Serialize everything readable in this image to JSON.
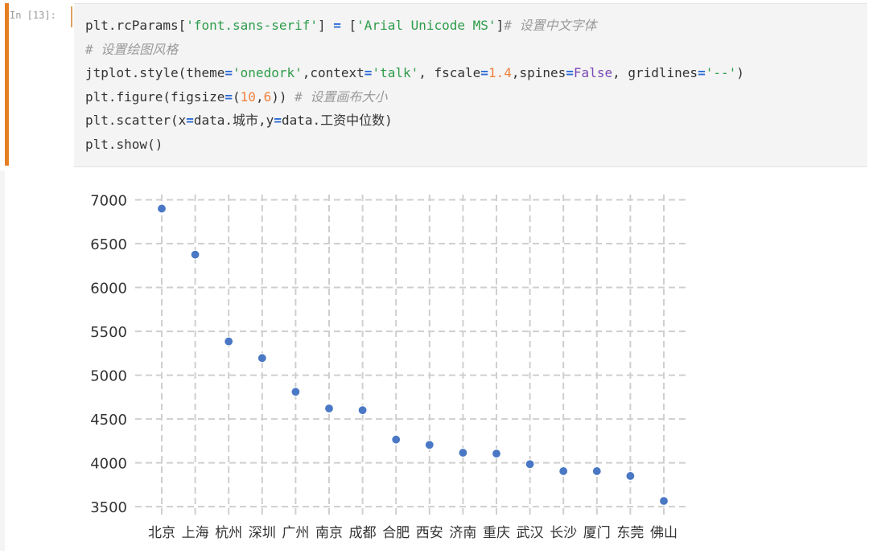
{
  "cell": {
    "prompt": "In [13]:",
    "code_lines": [
      [
        {
          "t": "plt.rcParams[",
          "c": ""
        },
        {
          "t": "'font.sans-serif'",
          "c": "str"
        },
        {
          "t": "] ",
          "c": ""
        },
        {
          "t": "=",
          "c": "op"
        },
        {
          "t": " [",
          "c": ""
        },
        {
          "t": "'Arial Unicode MS'",
          "c": "str"
        },
        {
          "t": "]",
          "c": ""
        },
        {
          "t": "# 设置中文字体",
          "c": "cm"
        }
      ],
      [
        {
          "t": "# 设置绘图风格",
          "c": "cm"
        }
      ],
      [
        {
          "t": "jtplot.style(theme",
          "c": ""
        },
        {
          "t": "=",
          "c": "op"
        },
        {
          "t": "'onedork'",
          "c": "str"
        },
        {
          "t": ",context",
          "c": ""
        },
        {
          "t": "=",
          "c": "op"
        },
        {
          "t": "'talk'",
          "c": "str"
        },
        {
          "t": ", fscale",
          "c": ""
        },
        {
          "t": "=",
          "c": "op"
        },
        {
          "t": "1.4",
          "c": "num"
        },
        {
          "t": ",spines",
          "c": ""
        },
        {
          "t": "=",
          "c": "op"
        },
        {
          "t": "False",
          "c": "kw"
        },
        {
          "t": ", gridlines",
          "c": ""
        },
        {
          "t": "=",
          "c": "op"
        },
        {
          "t": "'--'",
          "c": "str"
        },
        {
          "t": ")",
          "c": ""
        }
      ],
      [
        {
          "t": "plt.figure(figsize",
          "c": ""
        },
        {
          "t": "=",
          "c": "op"
        },
        {
          "t": "(",
          "c": ""
        },
        {
          "t": "10",
          "c": "num"
        },
        {
          "t": ",",
          "c": ""
        },
        {
          "t": "6",
          "c": "num"
        },
        {
          "t": ")) ",
          "c": ""
        },
        {
          "t": "# 设置画布大小",
          "c": "cm"
        }
      ],
      [
        {
          "t": "plt.scatter(x",
          "c": ""
        },
        {
          "t": "=",
          "c": "op"
        },
        {
          "t": "data.城市,y",
          "c": ""
        },
        {
          "t": "=",
          "c": "op"
        },
        {
          "t": "data.工资中位数)",
          "c": ""
        }
      ],
      [
        {
          "t": "plt.show()",
          "c": ""
        }
      ]
    ]
  },
  "colors": {
    "marker": "#4a78c4",
    "grid": "#cfcfcf",
    "tick_label": "#333333"
  },
  "chart_data": {
    "type": "scatter",
    "title": "",
    "xlabel": "",
    "ylabel": "",
    "categories": [
      "北京",
      "上海",
      "杭州",
      "深圳",
      "广州",
      "南京",
      "成都",
      "合肥",
      "西安",
      "济南",
      "重庆",
      "武汉",
      "长沙",
      "厦门",
      "东莞",
      "佛山"
    ],
    "values": [
      6900,
      6375,
      5385,
      5195,
      4810,
      4620,
      4600,
      4265,
      4205,
      4115,
      4105,
      3985,
      3905,
      3905,
      3850,
      3565
    ],
    "y_ticks": [
      3500,
      4000,
      4500,
      5000,
      5500,
      6000,
      6500,
      7000
    ],
    "ylim": [
      3400,
      7060
    ],
    "grid": true,
    "grid_style": "dashed",
    "legend": "none"
  }
}
